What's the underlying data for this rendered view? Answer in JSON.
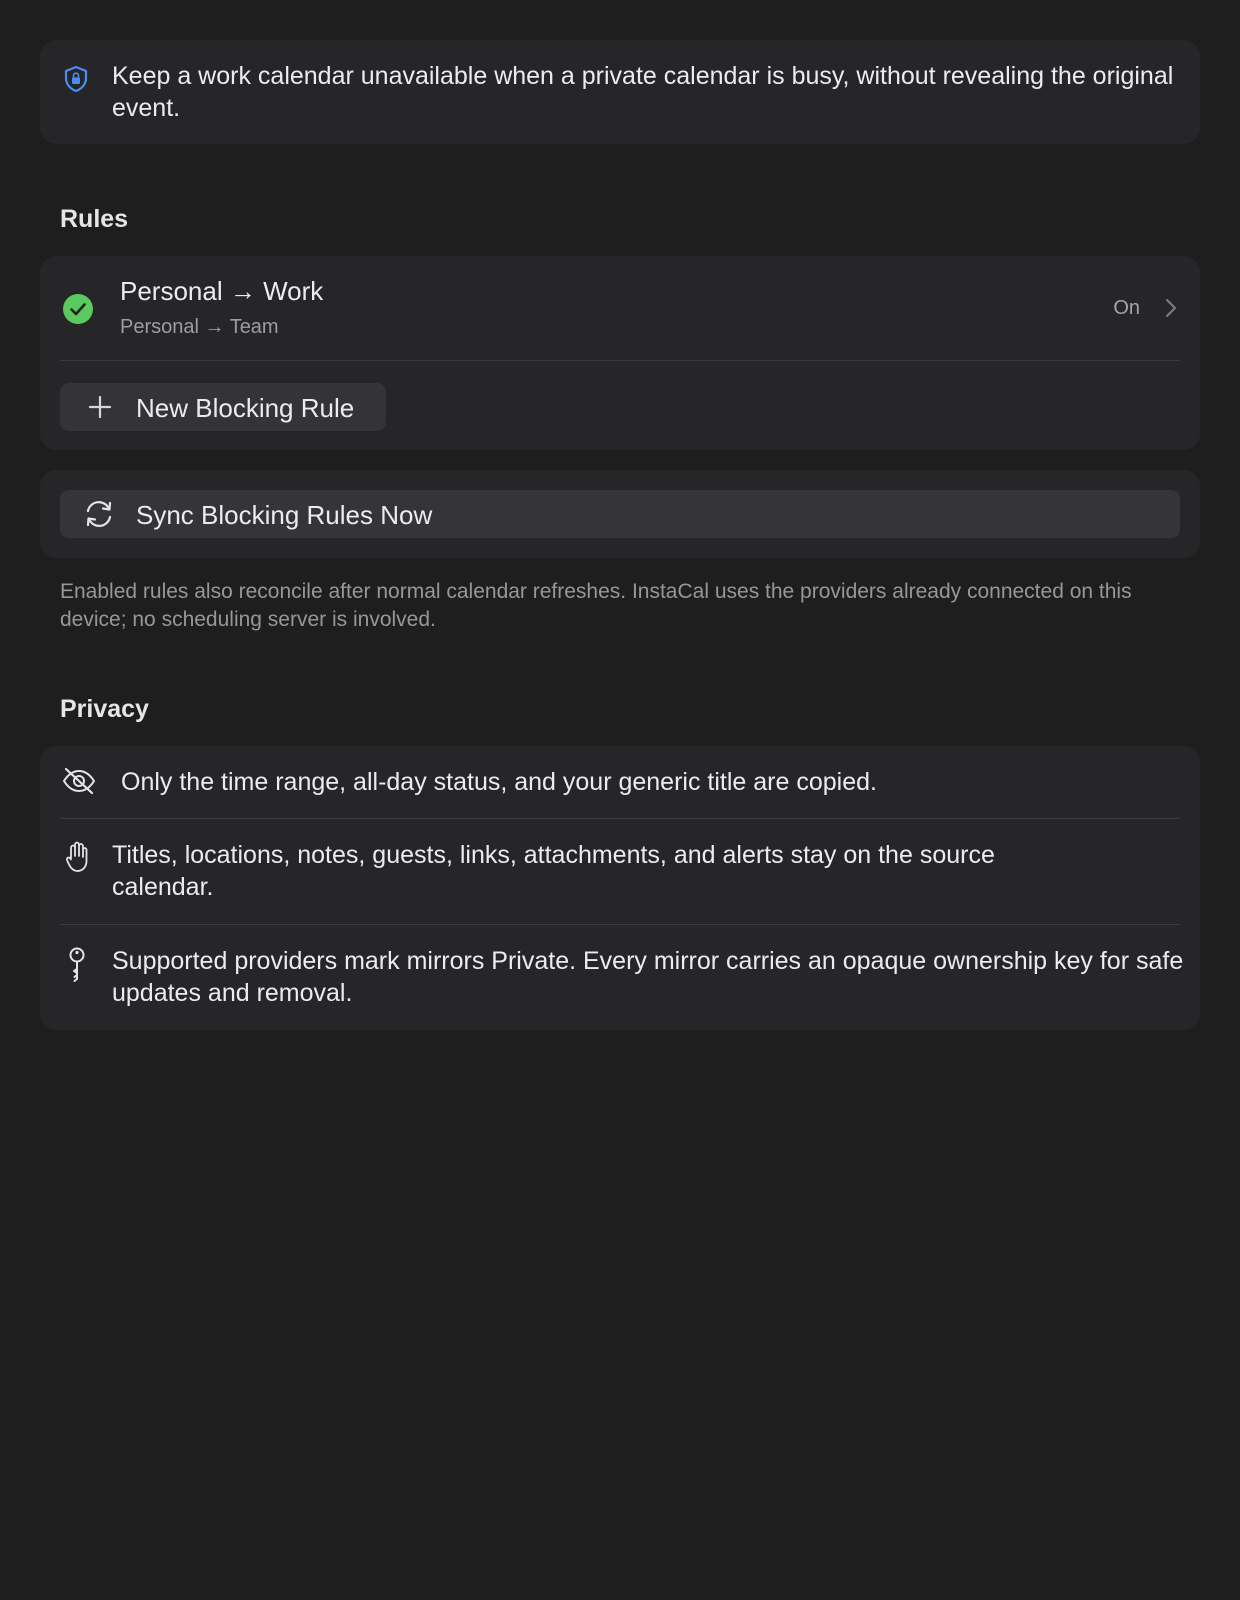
{
  "intro": {
    "icon": "shield-lock-icon",
    "text": "Keep a work calendar unavailable when a private calendar is busy, without revealing the original event."
  },
  "rules_section": {
    "title": "Rules",
    "rules": [
      {
        "title": "Personal → Work",
        "subtitle": "Personal → Team",
        "status": "On",
        "status_icon": "checkmark-circle-icon"
      }
    ],
    "new_rule_label": "New Blocking Rule"
  },
  "sync": {
    "label": "Sync Blocking Rules Now",
    "icon": "sync-arrows-icon"
  },
  "footnote": "Enabled rules also reconcile after normal calendar refreshes. InstaCal uses the providers already connected on this device; no scheduling server is involved.",
  "privacy": {
    "title": "Privacy",
    "items": [
      {
        "icon": "eye-slash-icon",
        "text": "Only the time range, all-day status, and your generic title are copied."
      },
      {
        "icon": "hand-raised-icon",
        "text": "Titles, locations, notes, guests, links, attachments, and alerts stay on the source calendar."
      },
      {
        "icon": "key-icon",
        "text": "Supported providers mark mirrors Private. Every mirror carries an opaque ownership key for safe updates and removal."
      }
    ]
  },
  "colors": {
    "background": "#1e1e1f",
    "card": "#262628",
    "accent_blue": "#4a8df6",
    "success_green": "#5ac95f",
    "secondary_text": "#9c9ca2"
  }
}
